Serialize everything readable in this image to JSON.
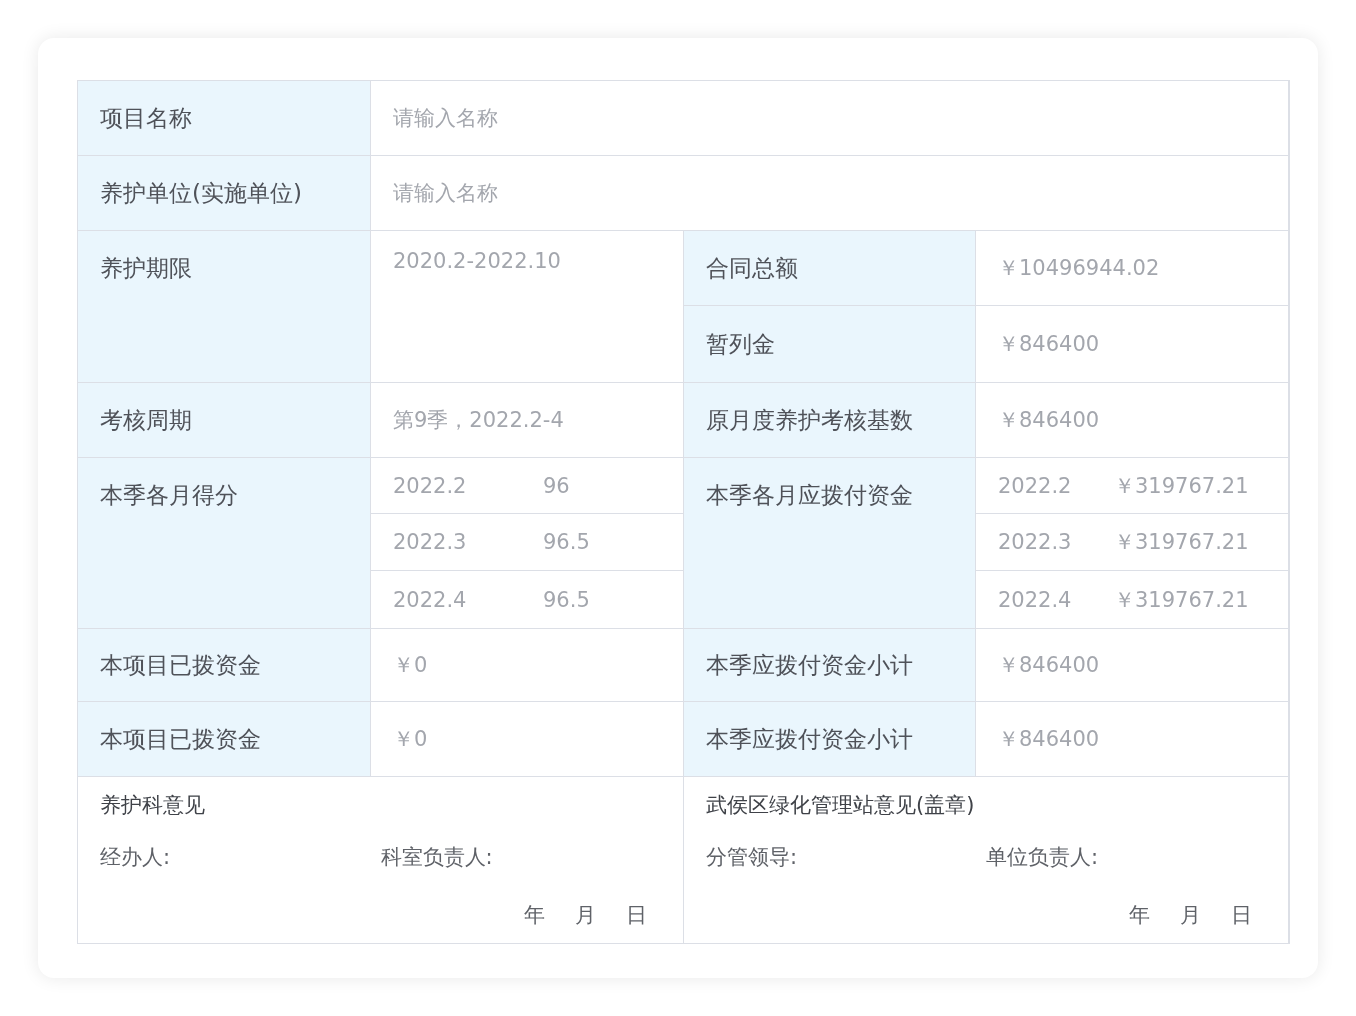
{
  "inputs": [
    {
      "label": "项目名称",
      "placeholder": "请输入名称"
    },
    {
      "label": "养护单位(实施单位)",
      "placeholder": "请输入名称"
    }
  ],
  "period": {
    "label": "养护期限",
    "value": "2020.2-2022.10"
  },
  "contract": [
    {
      "label": "合同总额",
      "value": "￥10496944.02"
    },
    {
      "label": "暂列金",
      "value": "￥846400"
    }
  ],
  "assessment": {
    "label": "考核周期",
    "value": "第9季，2022.2-4",
    "base_label": "原月度养护考核基数",
    "base_value": "￥846400"
  },
  "scores": {
    "label": "本季各月得分",
    "months": [
      {
        "month": "2022.2",
        "score": "96"
      },
      {
        "month": "2022.3",
        "score": "96.5"
      },
      {
        "month": "2022.4",
        "score": "96.5"
      }
    ]
  },
  "payments": {
    "label": "本季各月应拨付资金",
    "months": [
      {
        "month": "2022.2",
        "amount": "￥319767.21"
      },
      {
        "month": "2022.3",
        "amount": "￥319767.21"
      },
      {
        "month": "2022.4",
        "amount": "￥319767.21"
      }
    ]
  },
  "funds": [
    {
      "label": "本项目已拨资金",
      "value": "￥0",
      "sub_label": "本季应拨付资金小计",
      "sub_value": "￥846400"
    },
    {
      "label": "本项目已拨资金",
      "value": "￥0",
      "sub_label": "本季应拨付资金小计",
      "sub_value": "￥846400"
    }
  ],
  "opinions": [
    {
      "title": "养护科意见",
      "signers": [
        "经办人:",
        "科室负责人:"
      ],
      "date": [
        "年",
        "月",
        "日"
      ]
    },
    {
      "title": "武侯区绿化管理站意见(盖章)",
      "signers": [
        "分管领导:",
        "单位负责人:"
      ],
      "date": [
        "年",
        "月",
        "日"
      ]
    }
  ]
}
